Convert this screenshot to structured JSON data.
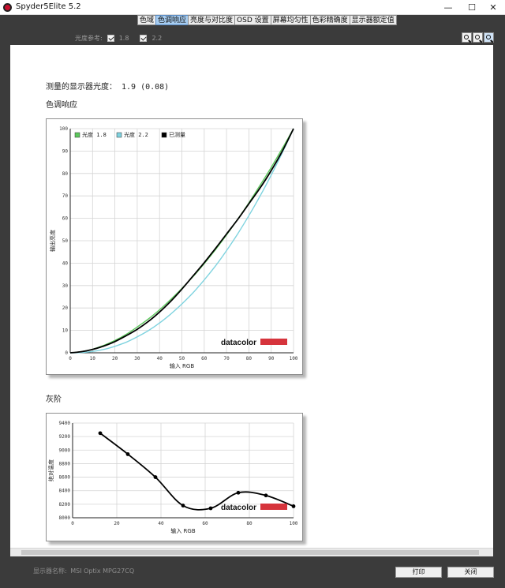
{
  "window": {
    "title": "Spyder5Elite 5.2",
    "controls": {
      "minimize": "—",
      "maximize": "☐",
      "close": "✕"
    }
  },
  "tabs": [
    {
      "label": "色域",
      "active": false
    },
    {
      "label": "色调响应",
      "active": true
    },
    {
      "label": "亮度与对比度",
      "active": false
    },
    {
      "label": "OSD 设置",
      "active": false
    },
    {
      "label": "屏幕均匀性",
      "active": false
    },
    {
      "label": "色彩精确度",
      "active": false
    },
    {
      "label": "显示器额定值",
      "active": false
    }
  ],
  "gamma_reference": {
    "label": "光度参考:",
    "options": [
      {
        "label": "1.8",
        "checked": true
      },
      {
        "label": "2.2",
        "checked": true
      }
    ]
  },
  "zoom_icons": [
    "zoom-in-icon",
    "zoom-out-icon",
    "zoom-fit-icon"
  ],
  "measured_gamma": {
    "label": "测量的显示器光度：",
    "value": "1.9 (0.08)"
  },
  "sections": {
    "tone_response": "色调响应",
    "grayscale": "灰阶"
  },
  "brand": {
    "text": "datacolor",
    "bar_color": "#d6343c"
  },
  "chart_data": [
    {
      "type": "line",
      "title": "",
      "xlabel": "输入 RGB",
      "ylabel": "输出亮度",
      "xlim": [
        0,
        100
      ],
      "ylim": [
        0,
        100
      ],
      "xticks": [
        0,
        10,
        20,
        30,
        40,
        50,
        60,
        70,
        80,
        90,
        100
      ],
      "yticks": [
        0,
        10,
        20,
        30,
        40,
        50,
        60,
        70,
        80,
        90,
        100
      ],
      "grid": true,
      "legend_position": "top-left",
      "x": [
        0,
        5,
        10,
        15,
        20,
        25,
        30,
        35,
        40,
        45,
        50,
        55,
        60,
        65,
        70,
        75,
        80,
        85,
        90,
        95,
        100
      ],
      "series": [
        {
          "name": "光度 1.8",
          "color": "#5cc85c",
          "values": [
            0,
            0.5,
            1.6,
            3.3,
            5.5,
            8.2,
            11.5,
            15.1,
            19.2,
            23.8,
            28.7,
            34.0,
            39.8,
            46.0,
            52.6,
            59.6,
            66.9,
            74.7,
            82.7,
            91.2,
            100
          ]
        },
        {
          "name": "光度 2.2",
          "color": "#7fd3df",
          "values": [
            0,
            0.1,
            0.6,
            1.5,
            2.9,
            4.7,
            7.1,
            9.9,
            13.3,
            17.3,
            21.8,
            26.8,
            32.5,
            38.7,
            45.6,
            53.1,
            61.2,
            69.9,
            79.3,
            89.3,
            100
          ]
        },
        {
          "name": "已测量",
          "color": "#000000",
          "values": [
            0,
            0.5,
            1.5,
            3.0,
            5.0,
            7.6,
            10.5,
            14.0,
            18.2,
            23.0,
            28.4,
            34.3,
            40.2,
            46.5,
            53.0,
            59.5,
            66.5,
            73.5,
            81.3,
            90.0,
            100
          ]
        }
      ]
    },
    {
      "type": "line",
      "title": "",
      "xlabel": "输入 RGB",
      "ylabel": "绝对温度",
      "xlim": [
        0,
        100
      ],
      "ylim": [
        8000,
        9400
      ],
      "xticks": [
        0,
        20,
        40,
        60,
        80,
        100
      ],
      "yticks": [
        8000,
        8200,
        8400,
        8600,
        8800,
        9000,
        9200,
        9400
      ],
      "grid": true,
      "x": [
        12.5,
        25,
        37.5,
        50,
        62.5,
        75,
        87.5,
        100
      ],
      "series": [
        {
          "name": "",
          "color": "#000000",
          "values": [
            9250,
            8940,
            8600,
            8180,
            8140,
            8370,
            8330,
            8170
          ]
        }
      ]
    }
  ],
  "status": {
    "label": "显示器名称:",
    "model": "MSI Optix MPG27CQ"
  },
  "buttons": {
    "print": "打印",
    "close": "关闭"
  }
}
